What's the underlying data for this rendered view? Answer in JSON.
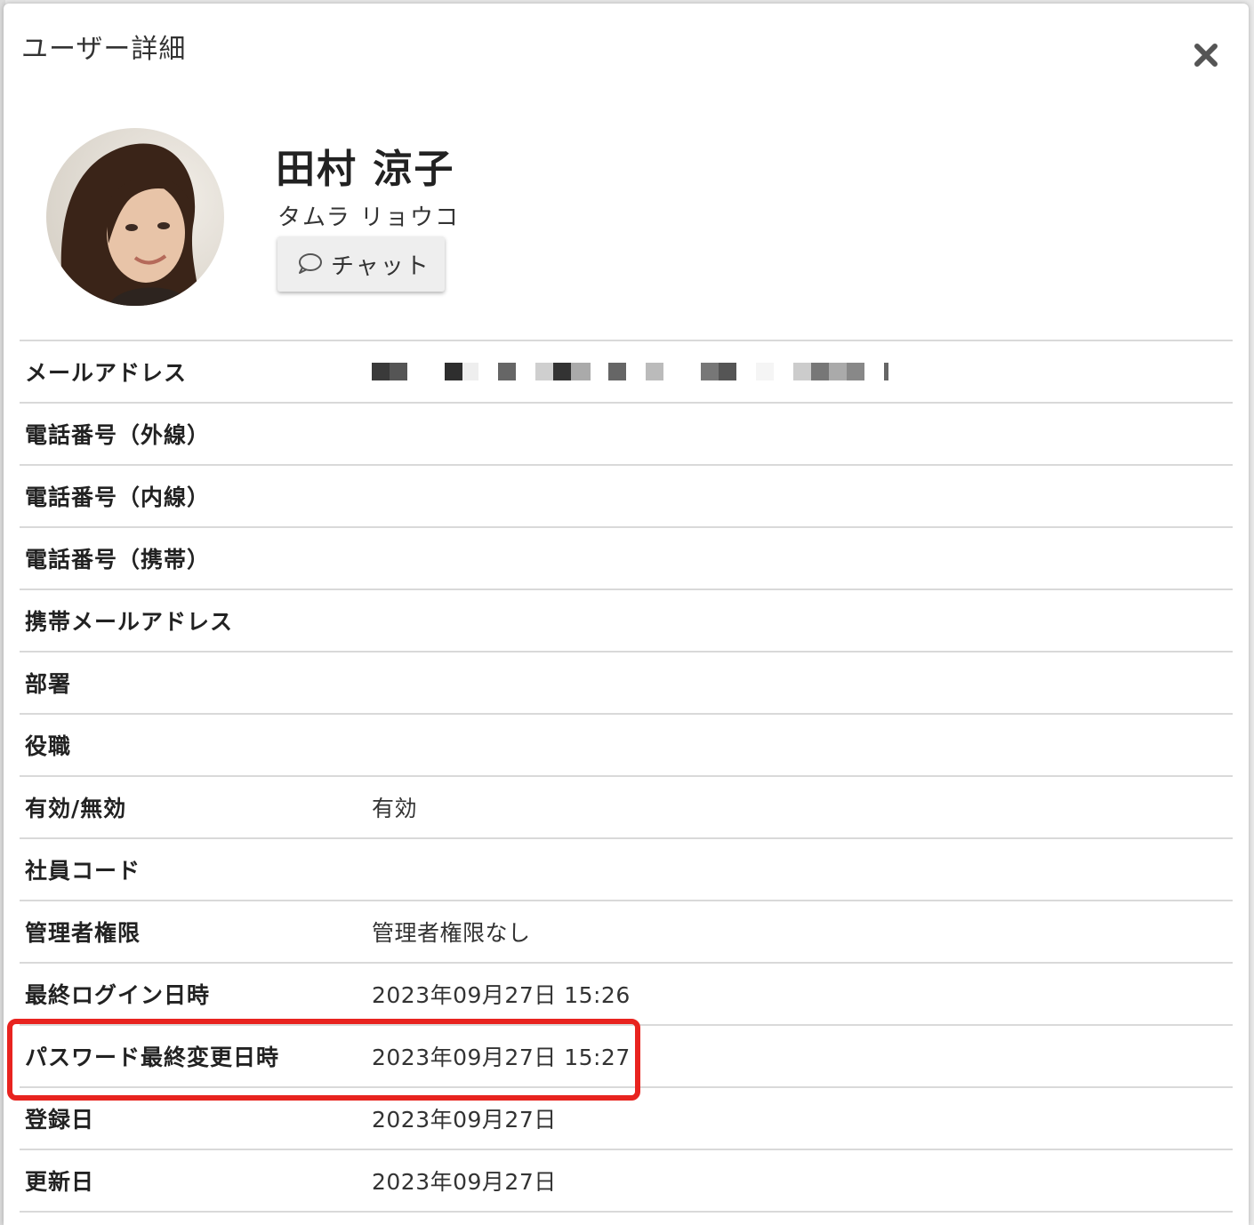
{
  "modal": {
    "title": "ユーザー詳細"
  },
  "user": {
    "name": "田村 涼子",
    "kana": "タムラ リョウコ"
  },
  "actions": {
    "chat_label": "チャット"
  },
  "fields": [
    {
      "label": "メールアドレス",
      "value": ""
    },
    {
      "label": "電話番号（外線）",
      "value": ""
    },
    {
      "label": "電話番号（内線）",
      "value": ""
    },
    {
      "label": "電話番号（携帯）",
      "value": ""
    },
    {
      "label": "携帯メールアドレス",
      "value": ""
    },
    {
      "label": "部署",
      "value": ""
    },
    {
      "label": "役職",
      "value": ""
    },
    {
      "label": "有効/無効",
      "value": "有効"
    },
    {
      "label": "社員コード",
      "value": ""
    },
    {
      "label": "管理者権限",
      "value": "管理者権限なし"
    },
    {
      "label": "最終ログイン日時",
      "value": "2023年09月27日 15:26"
    },
    {
      "label": "パスワード最終変更日時",
      "value": "2023年09月27日 15:27"
    },
    {
      "label": "登録日",
      "value": "2023年09月27日"
    },
    {
      "label": "更新日",
      "value": "2023年09月27日"
    }
  ],
  "colors": {
    "highlight": "#e8231f",
    "divider": "#d9d9d9"
  },
  "icons": {
    "close": "close-icon",
    "chat": "speech-bubble-icon"
  }
}
